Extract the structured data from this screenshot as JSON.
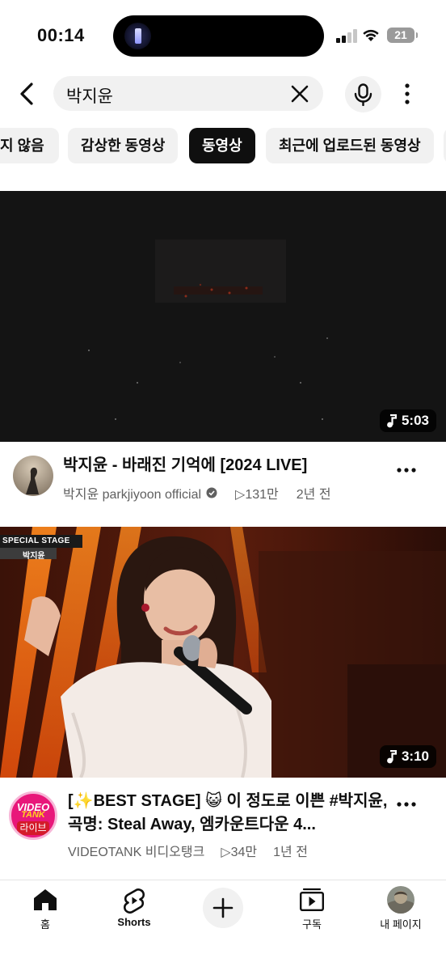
{
  "status_bar": {
    "time": "00:14",
    "battery": "21"
  },
  "search": {
    "query": "박지윤"
  },
  "chips": [
    "지 않음",
    "감상한 동영상",
    "동영상",
    "최근에 업로드된 동영상"
  ],
  "chip_active_index": 2,
  "videos": [
    {
      "title": "박지윤 - 바래진 기억에  [2024 LIVE]",
      "channel": "박지윤  parkjiyoon official",
      "views": "▷131만",
      "age": "2년 전",
      "duration": "5:03"
    },
    {
      "title": "[✨BEST STAGE] 😺 이 정도로 이쁜 #박지윤, 곡명: Steal Away, 엠카운트다운 4...",
      "channel": "VIDEOTANK 비디오탱크",
      "views": "▷34만",
      "age": "1년 전",
      "duration": "3:10",
      "thumb_overlay": {
        "label": "SPECIAL STAGE",
        "name": "박지윤"
      },
      "avatar_text": {
        "line1": "VIDEO",
        "line2": "TANK",
        "line3": "라이브"
      }
    }
  ],
  "tabs": {
    "home": "홈",
    "shorts": "Shorts",
    "subscriptions": "구독",
    "you": "내 페이지"
  },
  "colors": {
    "accent_red": "#e62117",
    "text_primary": "#0f0f0f",
    "text_secondary": "#606060",
    "chip_bg": "#f1f1f1"
  }
}
